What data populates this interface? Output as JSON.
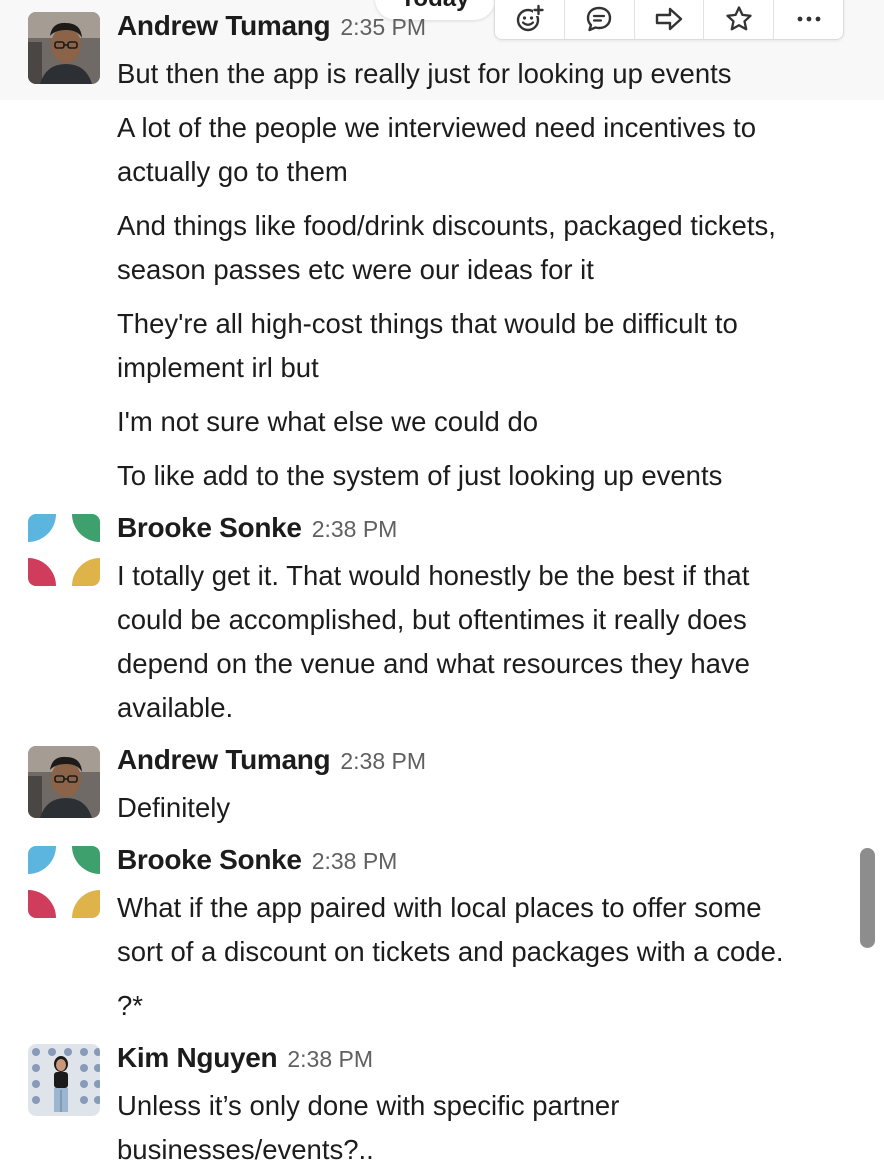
{
  "date_divider": "Today",
  "toolbar": {
    "buttons": [
      {
        "icon": "add-reaction-icon"
      },
      {
        "icon": "reply-thread-icon"
      },
      {
        "icon": "share-arrow-icon"
      },
      {
        "icon": "star-icon"
      },
      {
        "icon": "more-actions-icon"
      }
    ]
  },
  "messages": [
    {
      "author": "Andrew Tumang",
      "time": "2:35 PM",
      "lines": [
        "But then the app is really just for looking up events",
        "A lot of the people we interviewed need incentives to",
        "actually go to them",
        "And things like food/drink discounts, packaged tickets,",
        "season passes etc were our ideas for it",
        "They're all high-cost things that would be difficult to",
        "implement irl but",
        "I'm not sure what else we could do",
        "To like add to the system of just looking up events"
      ]
    },
    {
      "author": "Brooke Sonke",
      "time": "2:38 PM",
      "lines": [
        "I totally get it. That would honestly be the best if that",
        "could be accomplished, but oftentimes it really does",
        "depend on the venue and what resources they have",
        "available."
      ]
    },
    {
      "author": "Andrew Tumang",
      "time": "2:38 PM",
      "lines": [
        "Definitely"
      ]
    },
    {
      "author": "Brooke Sonke",
      "time": "2:38 PM",
      "lines": [
        "What if the app paired with local places to offer some",
        "sort of a discount on tickets and packages with a code.",
        "?*"
      ]
    },
    {
      "author": "Kim Nguyen",
      "time": "2:38 PM",
      "lines": [
        "Unless it’s only done with specific partner",
        "businesses/events?.."
      ]
    }
  ],
  "colors": {
    "text": "#1d1c1d",
    "timestamp": "#616061",
    "logo_blue": "#5bb5de",
    "logo_green": "#3ea06c",
    "logo_red": "#cf3c5c",
    "logo_yellow": "#deb34a"
  }
}
